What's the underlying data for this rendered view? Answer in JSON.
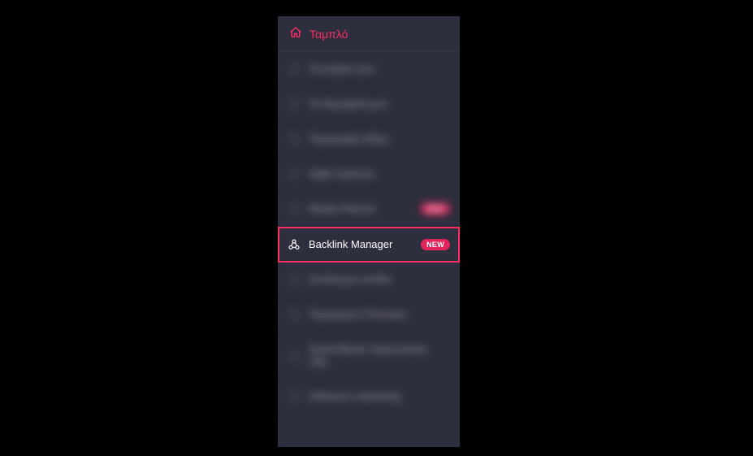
{
  "sidebar": {
    "header": {
      "label": "Ταμπλό"
    },
    "items": [
      {
        "label": "Τα project μου",
        "badge": null,
        "chevron": false
      },
      {
        "label": "Τα δημοφιλή μου",
        "badge": null,
        "chevron": true
      },
      {
        "label": "Περιγραφή λέξεις",
        "badge": null,
        "chevron": true
      },
      {
        "label": "Agile κειμένου",
        "badge": null,
        "chevron": true
      },
      {
        "label": "Media Planner",
        "badge": "NEW",
        "chevron": false
      },
      {
        "label": "Backlink Manager",
        "badge": "NEW",
        "chevron": false,
        "highlight": true
      },
      {
        "label": "Σύνδεσμοι σελίδα",
        "badge": null,
        "chevron": true
      },
      {
        "label": "Περιοχικών Premium",
        "badge": null,
        "chevron": true
      },
      {
        "label": "SearchBook παρουσίαση URL",
        "badge": null,
        "chevron": true
      },
      {
        "label": "Influence marketing",
        "badge": null,
        "chevron": true
      }
    ]
  }
}
